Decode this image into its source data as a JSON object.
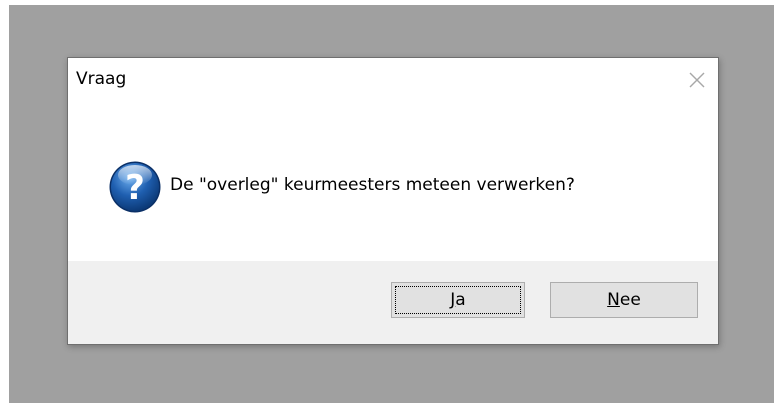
{
  "dialog": {
    "title": "Vraag",
    "message": "De \"overleg\" keurmeesters meteen verwerken?",
    "icon": "question-icon",
    "close_icon": "close-icon",
    "buttons": {
      "yes": {
        "accel": "J",
        "rest": "a"
      },
      "no": {
        "accel": "N",
        "rest": "ee"
      }
    }
  },
  "colors": {
    "backdrop": "#a0a0a0",
    "dialog_bg": "#ffffff",
    "footer_bg": "#f0f0f0",
    "button_bg": "#e1e1e1",
    "icon_blue": "#1f5fb0"
  }
}
